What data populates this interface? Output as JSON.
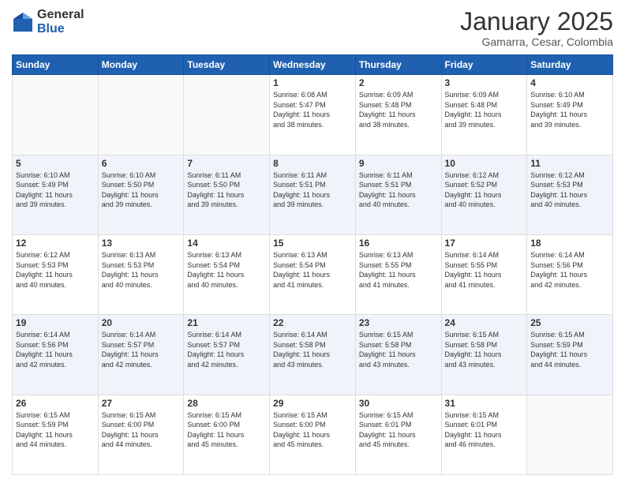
{
  "logo": {
    "general": "General",
    "blue": "Blue"
  },
  "header": {
    "month": "January 2025",
    "location": "Gamarra, Cesar, Colombia"
  },
  "weekdays": [
    "Sunday",
    "Monday",
    "Tuesday",
    "Wednesday",
    "Thursday",
    "Friday",
    "Saturday"
  ],
  "weeks": [
    [
      {
        "day": "",
        "info": ""
      },
      {
        "day": "",
        "info": ""
      },
      {
        "day": "",
        "info": ""
      },
      {
        "day": "1",
        "info": "Sunrise: 6:08 AM\nSunset: 5:47 PM\nDaylight: 11 hours\nand 38 minutes."
      },
      {
        "day": "2",
        "info": "Sunrise: 6:09 AM\nSunset: 5:48 PM\nDaylight: 11 hours\nand 38 minutes."
      },
      {
        "day": "3",
        "info": "Sunrise: 6:09 AM\nSunset: 5:48 PM\nDaylight: 11 hours\nand 39 minutes."
      },
      {
        "day": "4",
        "info": "Sunrise: 6:10 AM\nSunset: 5:49 PM\nDaylight: 11 hours\nand 39 minutes."
      }
    ],
    [
      {
        "day": "5",
        "info": "Sunrise: 6:10 AM\nSunset: 5:49 PM\nDaylight: 11 hours\nand 39 minutes."
      },
      {
        "day": "6",
        "info": "Sunrise: 6:10 AM\nSunset: 5:50 PM\nDaylight: 11 hours\nand 39 minutes."
      },
      {
        "day": "7",
        "info": "Sunrise: 6:11 AM\nSunset: 5:50 PM\nDaylight: 11 hours\nand 39 minutes."
      },
      {
        "day": "8",
        "info": "Sunrise: 6:11 AM\nSunset: 5:51 PM\nDaylight: 11 hours\nand 39 minutes."
      },
      {
        "day": "9",
        "info": "Sunrise: 6:11 AM\nSunset: 5:51 PM\nDaylight: 11 hours\nand 40 minutes."
      },
      {
        "day": "10",
        "info": "Sunrise: 6:12 AM\nSunset: 5:52 PM\nDaylight: 11 hours\nand 40 minutes."
      },
      {
        "day": "11",
        "info": "Sunrise: 6:12 AM\nSunset: 5:53 PM\nDaylight: 11 hours\nand 40 minutes."
      }
    ],
    [
      {
        "day": "12",
        "info": "Sunrise: 6:12 AM\nSunset: 5:53 PM\nDaylight: 11 hours\nand 40 minutes."
      },
      {
        "day": "13",
        "info": "Sunrise: 6:13 AM\nSunset: 5:53 PM\nDaylight: 11 hours\nand 40 minutes."
      },
      {
        "day": "14",
        "info": "Sunrise: 6:13 AM\nSunset: 5:54 PM\nDaylight: 11 hours\nand 40 minutes."
      },
      {
        "day": "15",
        "info": "Sunrise: 6:13 AM\nSunset: 5:54 PM\nDaylight: 11 hours\nand 41 minutes."
      },
      {
        "day": "16",
        "info": "Sunrise: 6:13 AM\nSunset: 5:55 PM\nDaylight: 11 hours\nand 41 minutes."
      },
      {
        "day": "17",
        "info": "Sunrise: 6:14 AM\nSunset: 5:55 PM\nDaylight: 11 hours\nand 41 minutes."
      },
      {
        "day": "18",
        "info": "Sunrise: 6:14 AM\nSunset: 5:56 PM\nDaylight: 11 hours\nand 42 minutes."
      }
    ],
    [
      {
        "day": "19",
        "info": "Sunrise: 6:14 AM\nSunset: 5:56 PM\nDaylight: 11 hours\nand 42 minutes."
      },
      {
        "day": "20",
        "info": "Sunrise: 6:14 AM\nSunset: 5:57 PM\nDaylight: 11 hours\nand 42 minutes."
      },
      {
        "day": "21",
        "info": "Sunrise: 6:14 AM\nSunset: 5:57 PM\nDaylight: 11 hours\nand 42 minutes."
      },
      {
        "day": "22",
        "info": "Sunrise: 6:14 AM\nSunset: 5:58 PM\nDaylight: 11 hours\nand 43 minutes."
      },
      {
        "day": "23",
        "info": "Sunrise: 6:15 AM\nSunset: 5:58 PM\nDaylight: 11 hours\nand 43 minutes."
      },
      {
        "day": "24",
        "info": "Sunrise: 6:15 AM\nSunset: 5:58 PM\nDaylight: 11 hours\nand 43 minutes."
      },
      {
        "day": "25",
        "info": "Sunrise: 6:15 AM\nSunset: 5:59 PM\nDaylight: 11 hours\nand 44 minutes."
      }
    ],
    [
      {
        "day": "26",
        "info": "Sunrise: 6:15 AM\nSunset: 5:59 PM\nDaylight: 11 hours\nand 44 minutes."
      },
      {
        "day": "27",
        "info": "Sunrise: 6:15 AM\nSunset: 6:00 PM\nDaylight: 11 hours\nand 44 minutes."
      },
      {
        "day": "28",
        "info": "Sunrise: 6:15 AM\nSunset: 6:00 PM\nDaylight: 11 hours\nand 45 minutes."
      },
      {
        "day": "29",
        "info": "Sunrise: 6:15 AM\nSunset: 6:00 PM\nDaylight: 11 hours\nand 45 minutes."
      },
      {
        "day": "30",
        "info": "Sunrise: 6:15 AM\nSunset: 6:01 PM\nDaylight: 11 hours\nand 45 minutes."
      },
      {
        "day": "31",
        "info": "Sunrise: 6:15 AM\nSunset: 6:01 PM\nDaylight: 11 hours\nand 46 minutes."
      },
      {
        "day": "",
        "info": ""
      }
    ]
  ]
}
